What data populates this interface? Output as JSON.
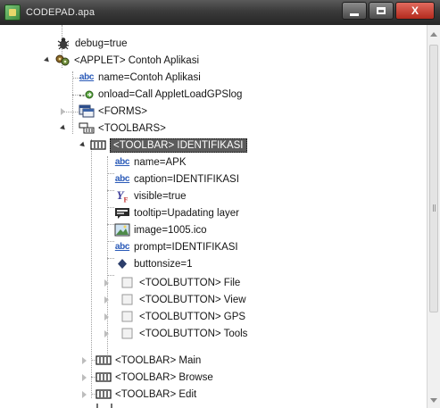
{
  "window": {
    "title": "CODEPAD.apa",
    "minimize_label": "",
    "maximize_label": "",
    "close_label": "X"
  },
  "tree": {
    "items": [
      {
        "label": "debug=true",
        "icon": "bug-icon"
      },
      {
        "label": "<APPLET> Contoh Aplikasi",
        "icon": "applet-icon",
        "expanded": true
      },
      {
        "label": "name=Contoh Aplikasi",
        "icon": "abc-text-icon"
      },
      {
        "label": "onload=Call AppletLoadGPSlog",
        "icon": "event-arrow-icon"
      },
      {
        "label": "<FORMS>",
        "icon": "forms-icon",
        "expanded": false
      },
      {
        "label": "<TOOLBARS>",
        "icon": "toolbars-icon",
        "expanded": true
      },
      {
        "label": "<TOOLBAR> IDENTIFIKASI",
        "icon": "toolbar-icon",
        "expanded": true,
        "selected": true
      },
      {
        "label": "name=APK",
        "icon": "abc-text-icon"
      },
      {
        "label": "caption=IDENTIFIKASI",
        "icon": "abc-text-icon"
      },
      {
        "label": "visible=true",
        "icon": "boolean-icon"
      },
      {
        "label": "tooltip=Upadating layer",
        "icon": "tooltip-icon"
      },
      {
        "label": "image=1005.ico",
        "icon": "image-icon"
      },
      {
        "label": "prompt=IDENTIFIKASI",
        "icon": "abc-text-icon"
      },
      {
        "label": "buttonsize=1",
        "icon": "number-icon"
      },
      {
        "label": "<TOOLBUTTON> File",
        "icon": "toolbutton-icon",
        "expanded": false
      },
      {
        "label": "<TOOLBUTTON> View",
        "icon": "toolbutton-icon",
        "expanded": false
      },
      {
        "label": "<TOOLBUTTON> GPS",
        "icon": "toolbutton-icon",
        "expanded": false
      },
      {
        "label": "<TOOLBUTTON> Tools",
        "icon": "toolbutton-icon",
        "expanded": false
      },
      {
        "label": "<TOOLBAR> Main",
        "icon": "toolbar-icon",
        "expanded": false
      },
      {
        "label": "<TOOLBAR> Browse",
        "icon": "toolbar-icon",
        "expanded": false
      },
      {
        "label": "<TOOLBAR> Edit",
        "icon": "toolbar-icon",
        "expanded": false
      }
    ]
  },
  "colors": {
    "selection": "#5c5c5c",
    "titlebar": "#3a3a3a",
    "close_button": "#c9392b",
    "abc_text": "#2a5ab8"
  }
}
